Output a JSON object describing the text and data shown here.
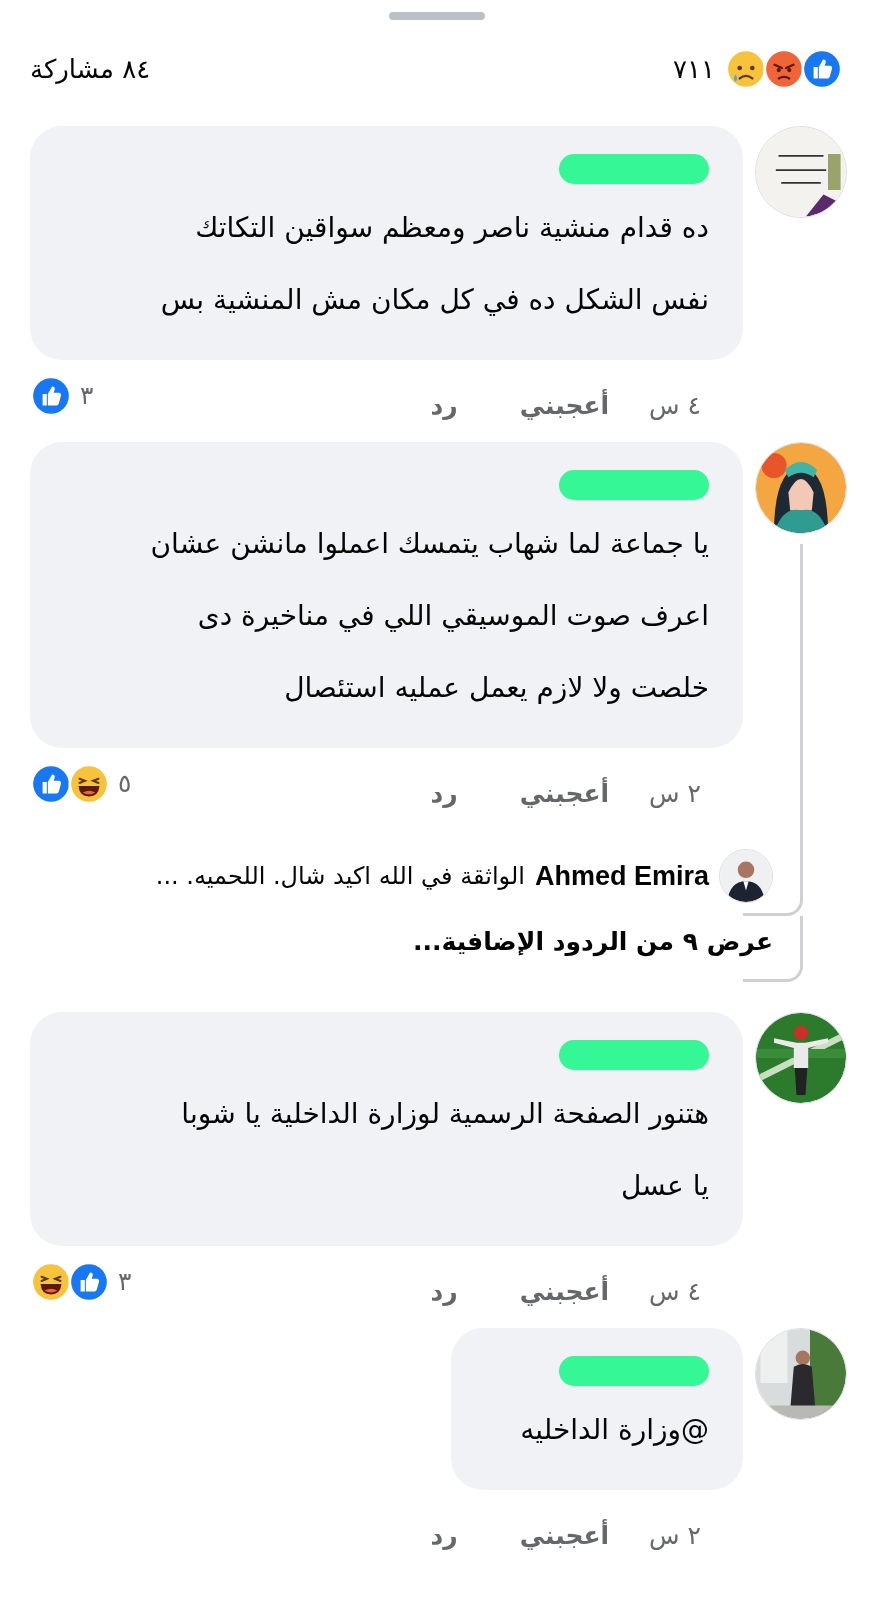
{
  "header": {
    "shares": "٨٤ مشاركة",
    "reaction_count": "٧١١",
    "reactions": [
      {
        "kind": "sad"
      },
      {
        "kind": "angry"
      },
      {
        "kind": "like"
      }
    ]
  },
  "comments": [
    {
      "author_redacted": true,
      "avatar": {
        "kind": "picture"
      },
      "lines": [
        "ده قدام منشية ناصر ومعظم سواقين التكاتك",
        "نفس الشكل ده في كل مكان مش المنشية بس"
      ],
      "time": "٤ س",
      "like": "أعجبني",
      "reply": "رد",
      "reactions": [
        {
          "kind": "like"
        }
      ],
      "reaction_count": "٣"
    },
    {
      "author_redacted": true,
      "avatar": {
        "kind": "picture"
      },
      "lines": [
        "يا جماعة لما شهاب يتمسك اعملوا مانشن عشان",
        "اعرف صوت الموسيقي اللي في مناخيرة دى",
        "خلصت ولا لازم يعمل عمليه استئصال"
      ],
      "time": "٢ س",
      "like": "أعجبني",
      "reply": "رد",
      "reactions": [
        {
          "kind": "like"
        },
        {
          "kind": "haha"
        }
      ],
      "reaction_count": "٥",
      "replies": {
        "author": "Ahmed Emira",
        "avatar": {
          "kind": "picture"
        },
        "text": "الواثقة في الله  اكيد شال. اللحميه. ...",
        "more": "عرض ٩ من الردود الإضافية..."
      }
    },
    {
      "author_redacted": true,
      "avatar": {
        "kind": "picture"
      },
      "lines": [
        "هتنور الصفحة الرسمية لوزارة الداخلية يا شوبا",
        "يا عسل"
      ],
      "time": "٤ س",
      "like": "أعجبني",
      "reply": "رد",
      "reactions": [
        {
          "kind": "haha"
        },
        {
          "kind": "like"
        }
      ],
      "reaction_count": "٣"
    },
    {
      "author_redacted": true,
      "avatar": {
        "kind": "picture"
      },
      "lines": [
        "@وزارة الداخليه"
      ],
      "time": "٢ س",
      "like": "أعجبني",
      "reply": "رد"
    }
  ]
}
